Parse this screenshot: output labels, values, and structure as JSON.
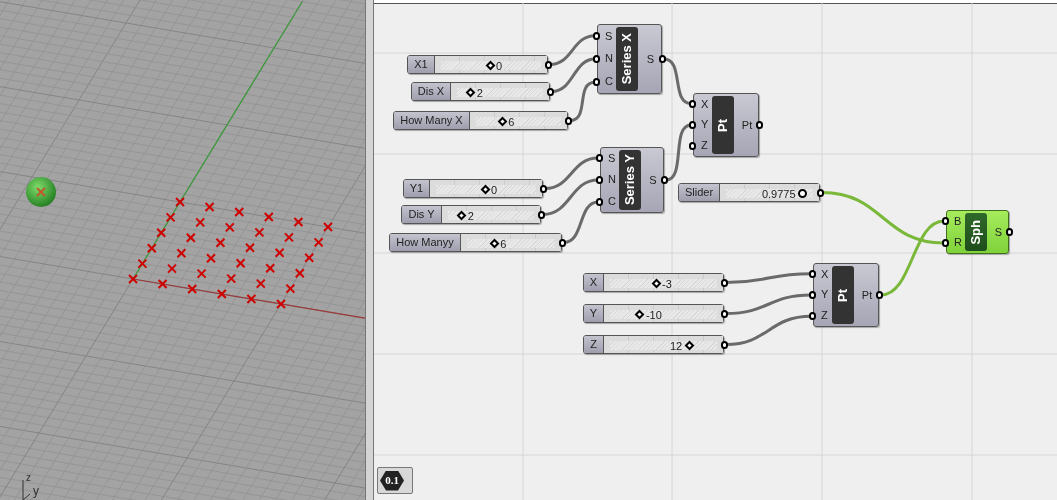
{
  "viewport": {
    "axis_labels": [
      "z",
      "y"
    ]
  },
  "canvas": {
    "sliders": [
      {
        "label": "X1",
        "value": "0",
        "kind": "integer",
        "level": 0.49
      },
      {
        "label": "Dis X",
        "value": "2",
        "kind": "integer",
        "level": 0.16
      },
      {
        "label": "How Many X",
        "value": "6",
        "kind": "integer",
        "level": 0.31
      },
      {
        "label": "Y1",
        "value": "0",
        "kind": "integer",
        "level": 0.49
      },
      {
        "label": "Dis Y",
        "value": "2",
        "kind": "integer",
        "level": 0.16
      },
      {
        "label": "How Manyy",
        "value": "6",
        "kind": "integer",
        "level": 0.31
      },
      {
        "label": "Slider",
        "value": "0.9775",
        "kind": "decimal",
        "level": 0.88
      },
      {
        "label": "X",
        "value": "-3",
        "kind": "integer",
        "level": 0.43
      },
      {
        "label": "Y",
        "value": "-10",
        "kind": "integer",
        "level": 0.28
      },
      {
        "label": "Z",
        "value": "12",
        "kind": "integer",
        "level": 0.74
      }
    ],
    "components": [
      {
        "name": "Series X",
        "inputs": [
          "S",
          "N",
          "C"
        ],
        "outputs": [
          "S"
        ],
        "selected": false
      },
      {
        "name": "Pt",
        "inputs": [
          "X",
          "Y",
          "Z"
        ],
        "outputs": [
          "Pt"
        ],
        "selected": false
      },
      {
        "name": "Series Y",
        "inputs": [
          "S",
          "N",
          "C"
        ],
        "outputs": [
          "S"
        ],
        "selected": false
      },
      {
        "name": "Pt",
        "inputs": [
          "X",
          "Y",
          "Z"
        ],
        "outputs": [
          "Pt"
        ],
        "selected": false
      },
      {
        "name": "Sph",
        "inputs": [
          "B",
          "R"
        ],
        "outputs": [
          "S"
        ],
        "selected": true
      }
    ],
    "zoom_badge": "0.1"
  }
}
